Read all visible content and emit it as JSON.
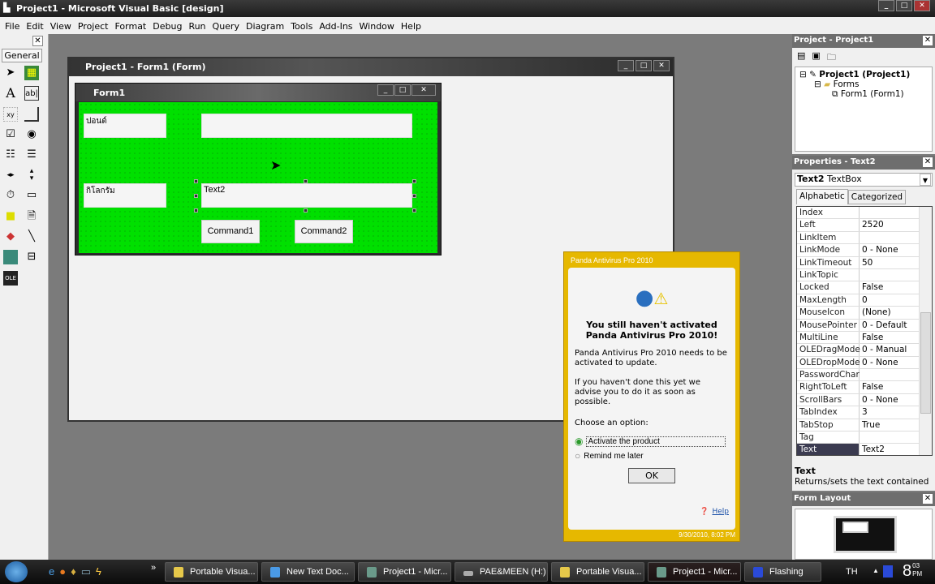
{
  "app": {
    "title": "Project1 - Microsoft Visual Basic [design]"
  },
  "menu": [
    "File",
    "Edit",
    "View",
    "Project",
    "Format",
    "Debug",
    "Run",
    "Query",
    "Diagram",
    "Tools",
    "Add-Ins",
    "Window",
    "Help"
  ],
  "toolbox": {
    "tab": "General",
    "tools": [
      "pointer-icon",
      "picturebox-icon",
      "label-icon",
      "textbox-icon",
      "frame-icon",
      "commandbutton-icon",
      "checkbox-icon",
      "optionbutton-icon",
      "combobox-icon",
      "listbox-icon",
      "hscrollbar-icon",
      "vscrollbar-icon",
      "timer-icon",
      "drivelistbox-icon",
      "dirlistbox-icon",
      "filelistbox-icon",
      "shape-icon",
      "line-icon",
      "image-icon",
      "data-icon",
      "ole-icon"
    ]
  },
  "designer": {
    "title": "Project1 - Form1 (Form)"
  },
  "form": {
    "title": "Form1",
    "label1": "ปอนด์",
    "label2": "กิโลกรัม",
    "text2": "Text2",
    "command1": "Command1",
    "command2": "Command2",
    "back_color": "#00e000"
  },
  "project": {
    "title": "Project - Project1",
    "root": "Project1 (Project1)",
    "folder": "Forms",
    "item": "Form1 (Form1)"
  },
  "properties": {
    "title": "Properties - Text2",
    "object_name": "Text2",
    "object_type": "TextBox",
    "tabs": [
      "Alphabetic",
      "Categorized"
    ],
    "rows": [
      [
        "Index",
        ""
      ],
      [
        "Left",
        "2520"
      ],
      [
        "LinkItem",
        ""
      ],
      [
        "LinkMode",
        "0 - None"
      ],
      [
        "LinkTimeout",
        "50"
      ],
      [
        "LinkTopic",
        ""
      ],
      [
        "Locked",
        "False"
      ],
      [
        "MaxLength",
        "0"
      ],
      [
        "MouseIcon",
        "(None)"
      ],
      [
        "MousePointer",
        "0 - Default"
      ],
      [
        "MultiLine",
        "False"
      ],
      [
        "OLEDragMode",
        "0 - Manual"
      ],
      [
        "OLEDropMode",
        "0 - None"
      ],
      [
        "PasswordChar",
        ""
      ],
      [
        "RightToLeft",
        "False"
      ],
      [
        "ScrollBars",
        "0 - None"
      ],
      [
        "TabIndex",
        "3"
      ],
      [
        "TabStop",
        "True"
      ],
      [
        "Tag",
        ""
      ],
      [
        "Text",
        "Text2"
      ]
    ],
    "desc_title": "Text",
    "desc": "Returns/sets the text contained"
  },
  "form_layout": {
    "title": "Form Layout"
  },
  "panda": {
    "title": "Panda Antivirus Pro 2010",
    "heading": "You still haven't activated Panda Antivirus Pro 2010!",
    "p1": "Panda Antivirus Pro 2010 needs to be activated to update.",
    "p2": "If you haven't done this yet we advise you to do it as soon as possible.",
    "choose": "Choose an option:",
    "opt1": "Activate the product",
    "opt2": "Remind me later",
    "selected": "Activate the product",
    "ok": "OK",
    "help": "Help",
    "footer": "9/30/2010, 8:02 PM",
    "accent": "#e6b800"
  },
  "taskbar": {
    "tasks": [
      "Portable Visua...",
      "New Text Doc...",
      "Project1 - Micr...",
      "PAE&MEEN (H:)",
      "Portable Visua...",
      "Project1 - Micr...",
      "Flashing"
    ],
    "lang": "TH",
    "time": "8",
    "time_sup": "03",
    "time_ampm": "PM"
  }
}
